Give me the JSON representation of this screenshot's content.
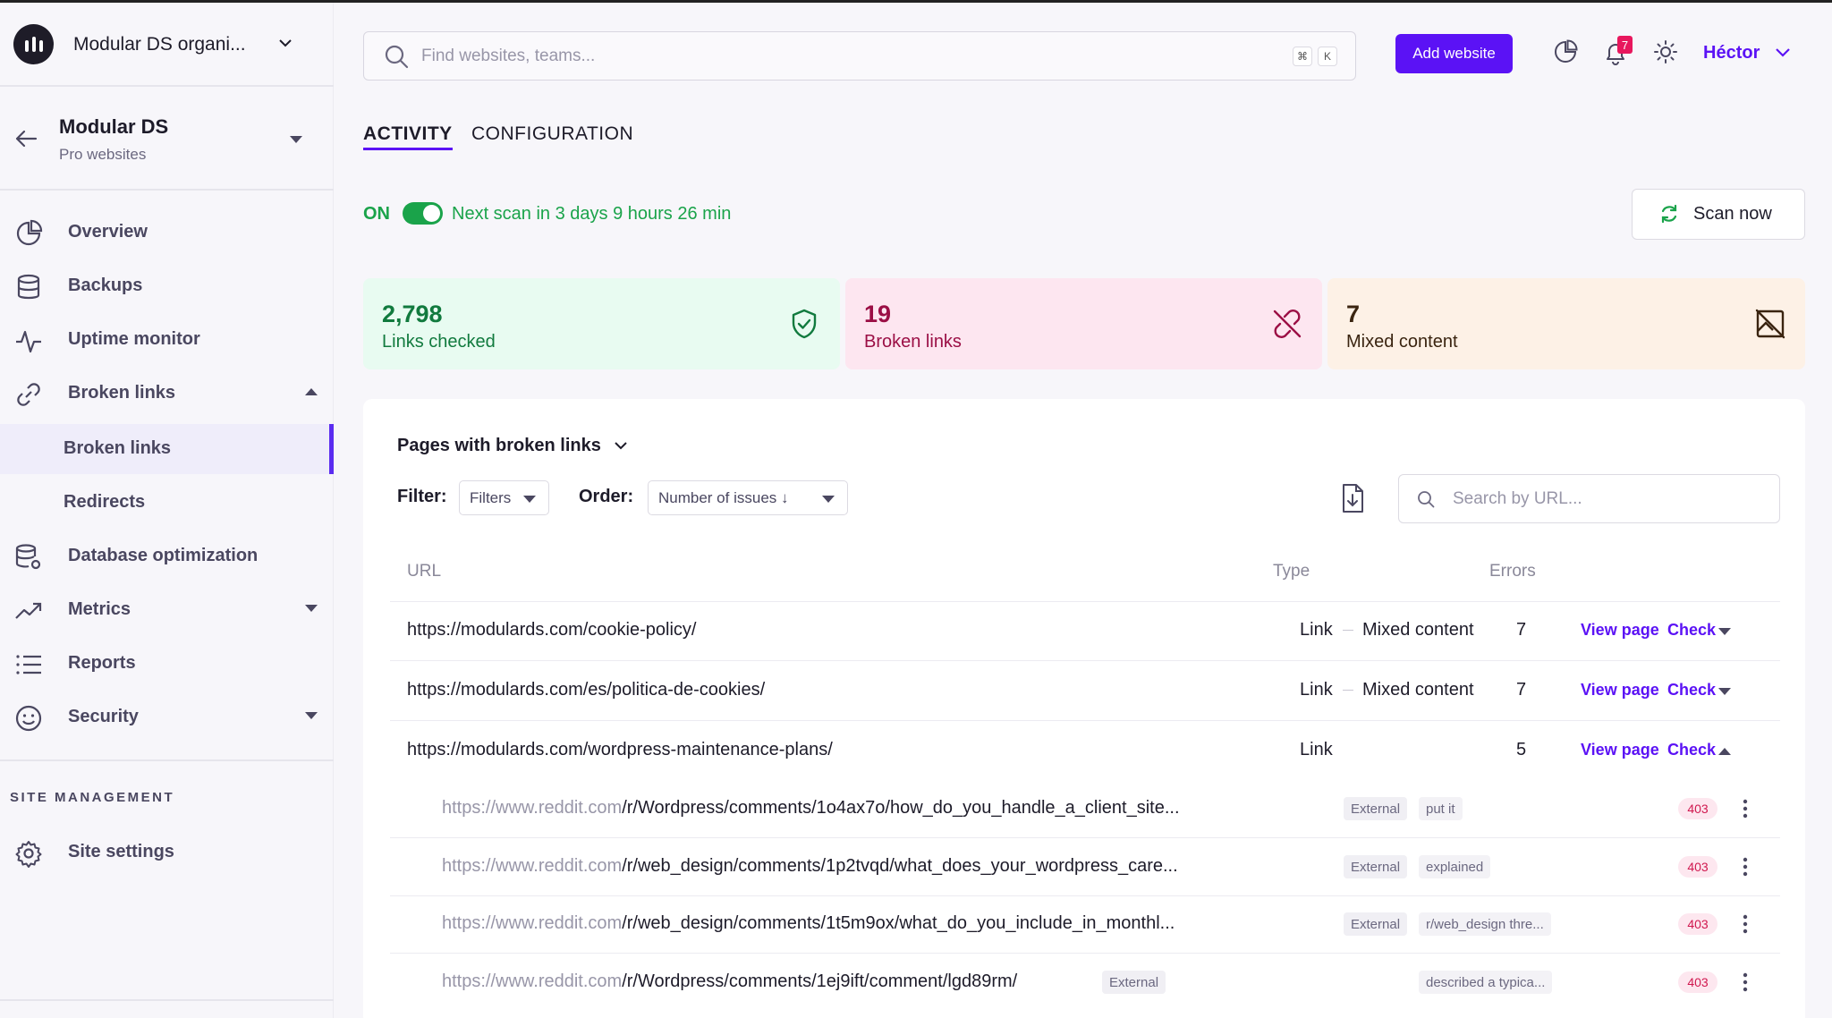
{
  "org": {
    "name": "Modular DS organi..."
  },
  "site": {
    "title": "Modular DS",
    "subtitle": "Pro websites"
  },
  "nav": {
    "overview": "Overview",
    "backups": "Backups",
    "uptime": "Uptime monitor",
    "broken_links": "Broken links",
    "sub_broken_links": "Broken links",
    "sub_redirects": "Redirects",
    "database": "Database optimization",
    "metrics": "Metrics",
    "reports": "Reports",
    "security": "Security"
  },
  "site_management": {
    "label": "SITE MANAGEMENT",
    "settings": "Site settings"
  },
  "header": {
    "search_placeholder": "Find websites, teams...",
    "kbd_cmd": "⌘",
    "kbd_k": "K",
    "add_website": "Add website",
    "notification_count": "7",
    "user_name": "Héctor"
  },
  "tabs": {
    "activity": "ACTIVITY",
    "configuration": "CONFIGURATION"
  },
  "scan": {
    "status": "ON",
    "next_scan": "Next scan in 3 days 9 hours 26 min",
    "scan_now": "Scan now"
  },
  "stats": {
    "checked": {
      "value": "2,798",
      "label": "Links checked",
      "bg": "#e8fbf1",
      "color": "#117a3e"
    },
    "broken": {
      "value": "19",
      "label": "Broken links",
      "bg": "#fde6f0",
      "color": "#9b0f45"
    },
    "mixed": {
      "value": "7",
      "label": "Mixed content",
      "bg": "#fdf1e6",
      "color": "#3a2410"
    }
  },
  "panel": {
    "title": "Pages with broken links",
    "filter_label": "Filter:",
    "filter_value": "Filters",
    "order_label": "Order:",
    "order_value": "Number of issues ↓",
    "url_search_placeholder": "Search by URL..."
  },
  "table": {
    "headers": {
      "url": "URL",
      "type": "Type",
      "errors": "Errors"
    },
    "view_label": "View page",
    "check_label": "Check",
    "rows": [
      {
        "url": "https://modulards.com/cookie-policy/",
        "type": "Link",
        "type2": "Mixed content",
        "errors": "7"
      },
      {
        "url": "https://modulards.com/es/politica-de-cookies/",
        "type": "Link",
        "type2": "Mixed content",
        "errors": "7"
      },
      {
        "url": "https://modulards.com/wordpress-maintenance-plans/",
        "type": "Link",
        "type2": "",
        "errors": "5"
      }
    ],
    "sub_rows": [
      {
        "host": "https://www.reddit.com",
        "path": "/r/Wordpress/comments/1o4ax7o/how_do_you_handle_a_client_site...",
        "tag": "External",
        "anchor": "put it",
        "code": "403"
      },
      {
        "host": "https://www.reddit.com",
        "path": "/r/web_design/comments/1p2tvqd/what_does_your_wordpress_care...",
        "tag": "External",
        "anchor": "explained",
        "code": "403"
      },
      {
        "host": "https://www.reddit.com",
        "path": "/r/web_design/comments/1t5m9ox/what_do_you_include_in_monthl...",
        "tag": "External",
        "anchor": "r/web_design thre...",
        "code": "403"
      },
      {
        "host": "https://www.reddit.com",
        "path": "/r/Wordpress/comments/1ej9ift/comment/lgd89rm/",
        "tag": "External",
        "anchor": "described a typica...",
        "code": "403"
      }
    ]
  },
  "colors": {
    "accent": "#5b12f5",
    "success": "#1aa34a",
    "danger": "#d0184f"
  }
}
